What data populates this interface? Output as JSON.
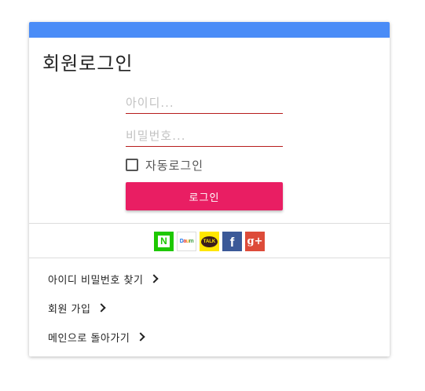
{
  "login": {
    "title": "회원로그인",
    "id_placeholder": "아이디...",
    "pw_placeholder": "비밀번호...",
    "auto_login_label": "자동로그인",
    "auto_login_checked": false,
    "submit_label": "로그인"
  },
  "social": {
    "providers": [
      "naver",
      "daum",
      "kakao",
      "facebook",
      "google-plus"
    ],
    "naver_glyph": "N",
    "daum_glyph": [
      "D",
      "a",
      "u",
      "m"
    ],
    "kakao_glyph": "TALK",
    "facebook_glyph": "f",
    "google_glyph": "g+"
  },
  "links": [
    {
      "label": "아이디 비밀번호 찾기"
    },
    {
      "label": "회원 가입"
    },
    {
      "label": "메인으로 돌아가기"
    }
  ],
  "colors": {
    "header_bar": "#4a8cf7",
    "input_underline": "#b71c1c",
    "login_button": "#e91e63",
    "naver": "#1ec800",
    "kakao": "#ffe600",
    "facebook": "#3b5998",
    "google": "#dd4b39"
  }
}
